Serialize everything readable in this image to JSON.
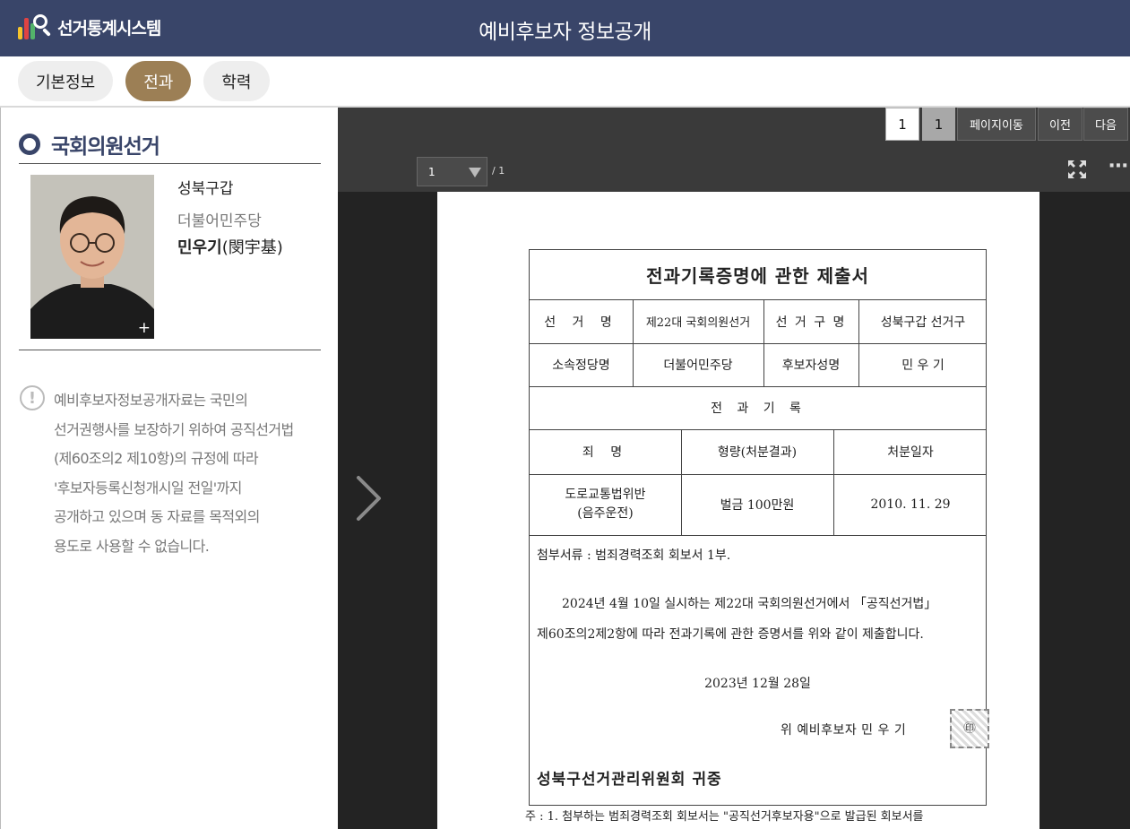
{
  "header": {
    "logo_text": "선거통계시스템",
    "title": "예비후보자 정보공개"
  },
  "tabs": [
    {
      "label": "기본정보",
      "active": false
    },
    {
      "label": "전과",
      "active": true
    },
    {
      "label": "학력",
      "active": false
    }
  ],
  "candidate": {
    "section_title": "국회의원선거",
    "district": "성북구갑",
    "party": "더불어민주당",
    "name": "민우기",
    "name_hanja": "(閔宇基)",
    "photo_expand": "+"
  },
  "notice": {
    "lines": [
      "예비후보자정보공개자료는 국민의",
      "선거권행사를 보장하기 위하여 공직선거법",
      "(제60조의2 제10항)의 규정에 따라",
      "'후보자등록신청개시일 전일'까지",
      "공개하고 있으며 동 자료를 목적외의",
      "용도로 사용할 수 없습니다."
    ]
  },
  "viewer": {
    "current_page": "1",
    "total_pages": "1",
    "btn_goto": "페이지이동",
    "btn_prev": "이전",
    "btn_next": "다음",
    "page_select_value": "1",
    "page_count": "/ 1",
    "more": "⋯"
  },
  "document": {
    "title": "전과기록증명에 관한 제출서",
    "row1": [
      "선 거 명",
      "제22대 국회의원선거",
      "선 거 구 명",
      "성북구갑 선거구"
    ],
    "row2": [
      "소속정당명",
      "더불어민주당",
      "후보자성명",
      "민 우 기"
    ],
    "record_heading": "전 과 기 록",
    "record_cols": [
      "죄 명",
      "형량(처분결과)",
      "처분일자"
    ],
    "record_row": {
      "crime_line1": "도로교통법위반",
      "crime_line2": "(음주운전)",
      "sentence": "벌금 100만원",
      "date": "2010. 11. 29"
    },
    "attachment": "첨부서류 : 범죄경력조회 회보서 1부.",
    "body1": "2024년 4월 10일 실시하는 제22대 국회의원선거에서 「공직선거법」",
    "body2": "제60조의2제2항에 따라 전과기록에 관한 증명서를 위와 같이 제출합니다.",
    "date": "2023년 12월 28일",
    "signer": "위 예비후보자 민 우 기",
    "seal_mark": "㊞",
    "addressee": "성북구선거관리위원회 귀중",
    "footnote": "주 : 1. 첨부하는 범죄경력조회 회보서는 \"공직선거후보자용\"으로 발급된 회보서를"
  }
}
